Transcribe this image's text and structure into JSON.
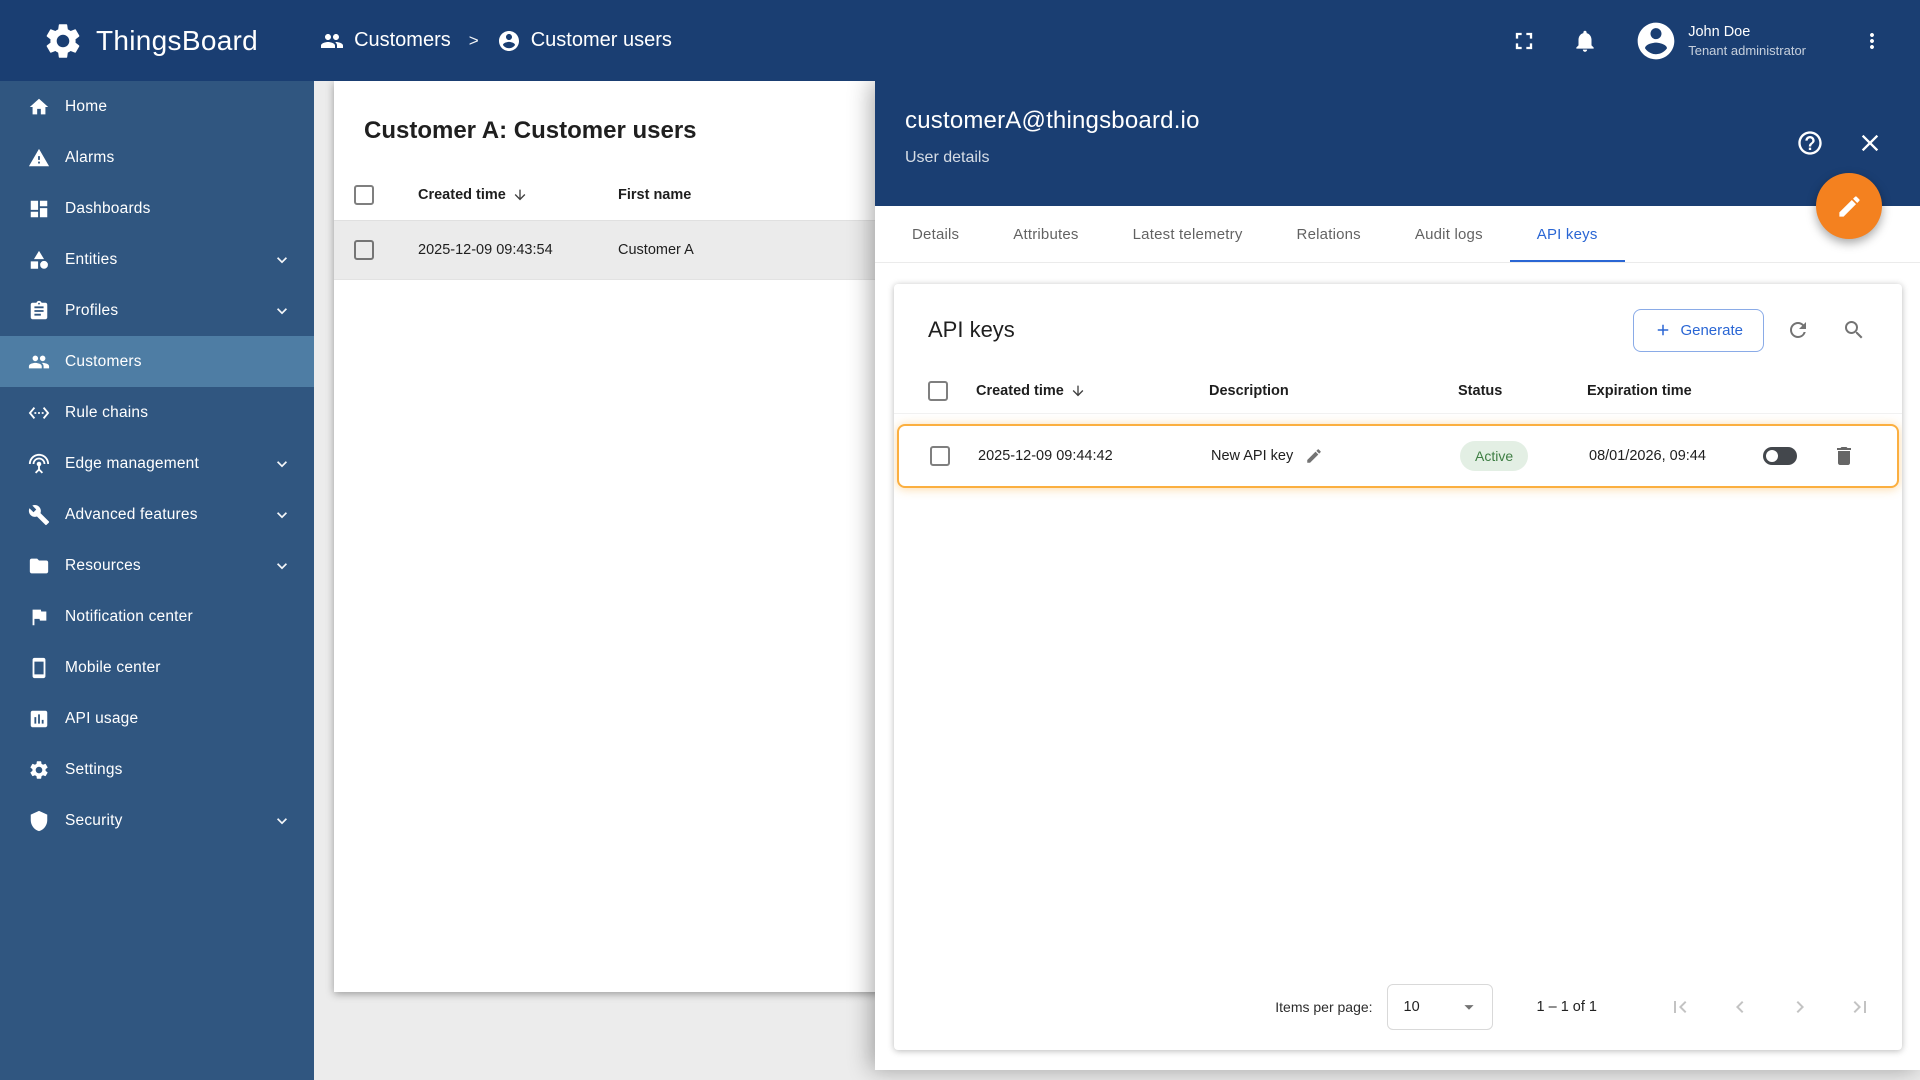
{
  "colors": {
    "header-blue": "#1a3e72",
    "sidebar-blue": "#305680",
    "sidebar-active": "#4e7da4",
    "accent": "#2a66d4",
    "fab-orange": "#f4811f",
    "row-highlight": "#fbaf40",
    "status-bg": "#e3efe4",
    "status-text": "#3e7e43",
    "page-bg": "#ececec"
  },
  "header": {
    "logo_text": "ThingsBoard",
    "breadcrumb": {
      "separator": ">",
      "items": [
        {
          "icon": "customers",
          "label": "Customers"
        },
        {
          "icon": "account",
          "label": "Customer users"
        }
      ]
    },
    "user": {
      "name": "John Doe",
      "role": "Tenant administrator"
    }
  },
  "sidebar": {
    "items": [
      {
        "icon": "home",
        "label": "Home",
        "expandable": false
      },
      {
        "icon": "alarms",
        "label": "Alarms",
        "expandable": false
      },
      {
        "icon": "dashboards",
        "label": "Dashboards",
        "expandable": false
      },
      {
        "icon": "entities",
        "label": "Entities",
        "expandable": true
      },
      {
        "icon": "profiles",
        "label": "Profiles",
        "expandable": true
      },
      {
        "icon": "customers",
        "label": "Customers",
        "expandable": false,
        "active": true
      },
      {
        "icon": "rule-chains",
        "label": "Rule chains",
        "expandable": false
      },
      {
        "icon": "edge",
        "label": "Edge management",
        "expandable": true
      },
      {
        "icon": "advanced",
        "label": "Advanced features",
        "expandable": true
      },
      {
        "icon": "resources",
        "label": "Resources",
        "expandable": true
      },
      {
        "icon": "notification",
        "label": "Notification center",
        "expandable": false
      },
      {
        "icon": "mobile",
        "label": "Mobile center",
        "expandable": false
      },
      {
        "icon": "api-usage",
        "label": "API usage",
        "expandable": false
      },
      {
        "icon": "settings",
        "label": "Settings",
        "expandable": false
      },
      {
        "icon": "security",
        "label": "Security",
        "expandable": true
      }
    ]
  },
  "customer_users": {
    "title": "Customer A: Customer users",
    "columns": [
      "Created time",
      "First name"
    ],
    "rows": [
      {
        "created_time": "2025-12-09 09:43:54",
        "first_name": "Customer A"
      }
    ]
  },
  "user_details": {
    "title": "customerA@thingsboard.io",
    "subtitle": "User details",
    "tabs": [
      "Details",
      "Attributes",
      "Latest telemetry",
      "Relations",
      "Audit logs",
      "API keys"
    ],
    "active_tab": "API keys",
    "api_keys": {
      "title": "API keys",
      "generate_label": "Generate",
      "columns": [
        "Created time",
        "Description",
        "Status",
        "Expiration time"
      ],
      "rows": [
        {
          "created_time": "2025-12-09 09:44:42",
          "description": "New API key",
          "status": "Active",
          "expiration": "08/01/2026, 09:44",
          "enabled": true
        }
      ],
      "pagination": {
        "items_per_page_label": "Items per page:",
        "items_per_page": "10",
        "range": "1 – 1 of 1"
      }
    }
  }
}
